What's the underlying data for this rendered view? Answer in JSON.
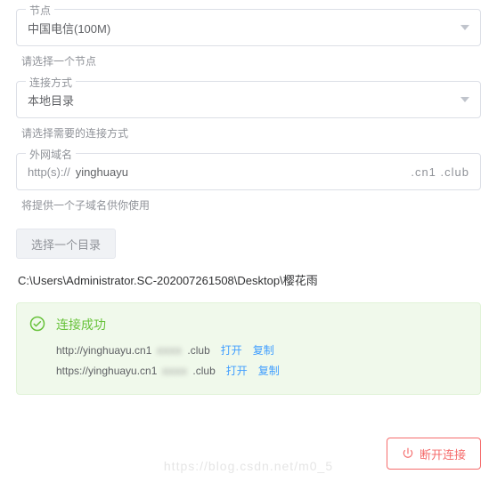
{
  "node": {
    "legend": "节点",
    "value": "中国电信(100M)",
    "hint": "请选择一个节点"
  },
  "method": {
    "legend": "连接方式",
    "value": "本地目录",
    "hint": "请选择需要的连接方式"
  },
  "domain": {
    "legend": "外网域名",
    "prefix": "http(s)://",
    "input": "yinghuayu",
    "suffix": ".cn1        .club",
    "hint": "将提供一个子域名供你使用"
  },
  "dirButton": "选择一个目录",
  "path": "C:\\Users\\Administrator.SC-202007261508\\Desktop\\樱花雨",
  "alert": {
    "title": "连接成功",
    "urls": [
      {
        "text": "http://yinghuayu.cn1",
        "mask": "xxxx",
        "tail": ".club"
      },
      {
        "text": "https://yinghuayu.cn1",
        "mask": "xxxx",
        "tail": ".club"
      }
    ],
    "open": "打开",
    "copy": "复制"
  },
  "disconnect": "断开连接",
  "watermark": "https://blog.csdn.net/m0_5"
}
